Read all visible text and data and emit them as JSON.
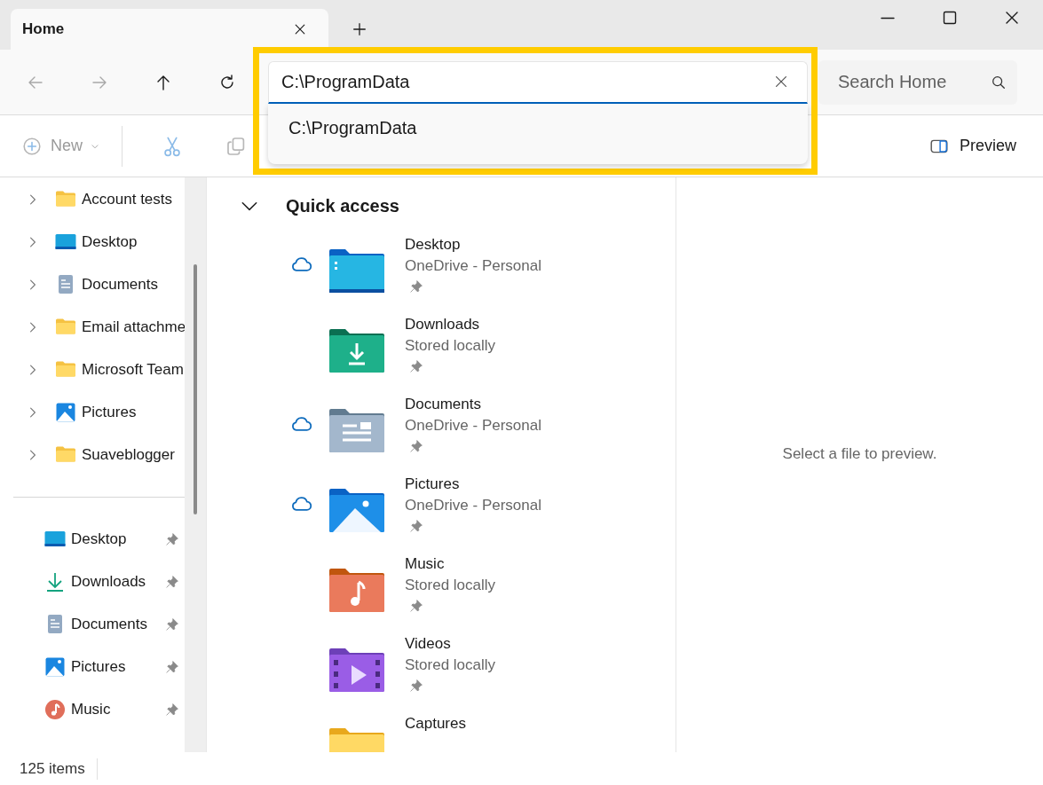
{
  "tabs": [
    {
      "label": "Home",
      "selected": true
    }
  ],
  "nav": [
    {
      "kind": "back",
      "disabled": true
    },
    {
      "kind": "forward",
      "disabled": true
    },
    {
      "kind": "up",
      "disabled": false
    },
    {
      "kind": "refresh",
      "disabled": false
    }
  ],
  "address_bar": {
    "value": "C:\\ProgramData",
    "highlighted": true,
    "suggestions": [
      "C:\\ProgramData"
    ]
  },
  "search": {
    "placeholder": "Search Home"
  },
  "command_bar": {
    "new_button": {
      "label": "New",
      "disabled": true
    },
    "tools": [
      {
        "kind": "cut",
        "disabled": true
      },
      {
        "kind": "copy",
        "disabled": true
      }
    ],
    "preview_button": {
      "label": "Preview"
    }
  },
  "sidebar": {
    "tree": [
      {
        "label": "Account tests",
        "kind": "folder",
        "expanded": false
      },
      {
        "label": "Desktop",
        "kind": "desktop",
        "expanded": false
      },
      {
        "label": "Documents",
        "kind": "documents",
        "expanded": false
      },
      {
        "label": "Email attachme",
        "kind": "folder",
        "expanded": false
      },
      {
        "label": "Microsoft Team",
        "kind": "folder",
        "expanded": false
      },
      {
        "label": "Pictures",
        "kind": "pictures",
        "expanded": false
      },
      {
        "label": "Suaveblogger",
        "kind": "folder",
        "expanded": false
      }
    ],
    "pinned": [
      {
        "label": "Desktop",
        "kind": "desktop",
        "pinned": true
      },
      {
        "label": "Downloads",
        "kind": "downloads",
        "pinned": true
      },
      {
        "label": "Documents",
        "kind": "documents",
        "pinned": true
      },
      {
        "label": "Pictures",
        "kind": "pictures",
        "pinned": true
      },
      {
        "label": "Music",
        "kind": "music",
        "pinned": true
      }
    ]
  },
  "quick_access": {
    "title": "Quick access",
    "expanded": true,
    "items": [
      {
        "name": "Desktop",
        "location": "OneDrive - Personal",
        "kind": "desktop",
        "cloud": true,
        "pinned": true
      },
      {
        "name": "Downloads",
        "location": "Stored locally",
        "kind": "downloads",
        "cloud": false,
        "pinned": true
      },
      {
        "name": "Documents",
        "location": "OneDrive - Personal",
        "kind": "documents",
        "cloud": true,
        "pinned": true
      },
      {
        "name": "Pictures",
        "location": "OneDrive - Personal",
        "kind": "pictures",
        "cloud": true,
        "pinned": true
      },
      {
        "name": "Music",
        "location": "Stored locally",
        "kind": "music",
        "cloud": false,
        "pinned": true
      },
      {
        "name": "Videos",
        "location": "Stored locally",
        "kind": "videos",
        "cloud": false,
        "pinned": true
      },
      {
        "name": "Captures",
        "kind": "folder",
        "cloud": false,
        "pinned": false
      }
    ]
  },
  "preview_pane": {
    "message": "Select a file to preview."
  },
  "status_bar": {
    "items_count": "125 items"
  }
}
